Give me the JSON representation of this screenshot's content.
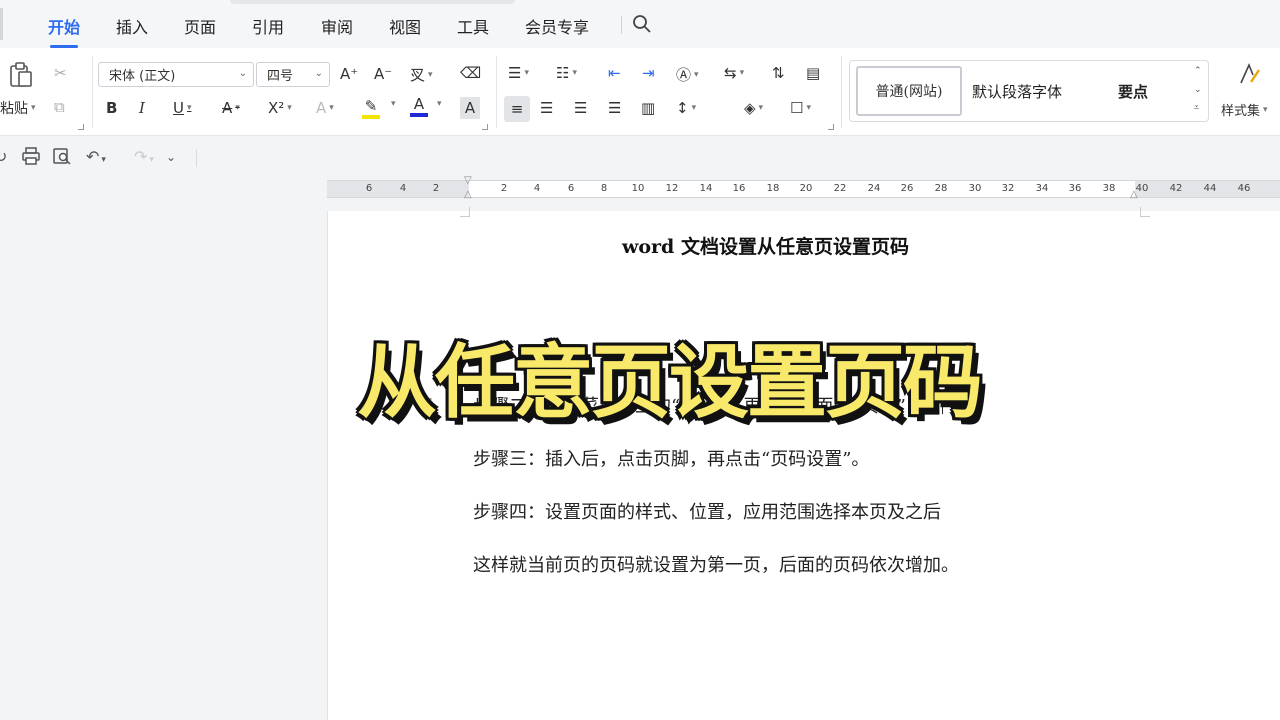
{
  "menu": {
    "tabs": [
      {
        "label": "开始",
        "active": true
      },
      {
        "label": "插入",
        "active": false
      },
      {
        "label": "页面",
        "active": false
      },
      {
        "label": "引用",
        "active": false
      },
      {
        "label": "审阅",
        "active": false
      },
      {
        "label": "视图",
        "active": false
      },
      {
        "label": "工具",
        "active": false
      },
      {
        "label": "会员专享",
        "active": false
      }
    ],
    "search_icon": "search-icon"
  },
  "ribbon": {
    "paste_label": "粘贴",
    "font_name": "宋体 (正文)",
    "font_size": "四号",
    "buttons": {
      "bold": "B",
      "italic": "I",
      "underline": "U",
      "strikethrough": "A",
      "superscript": "X²",
      "grow_font": "A⁺",
      "shrink_font": "A⁻",
      "font_color": "A",
      "char_shading": "A"
    },
    "styles": {
      "normal": "普通(网站)",
      "default_para_font": "默认段落字体",
      "key_point": "要点",
      "gallery_label": "样式集"
    },
    "colors": {
      "highlight": "#f2e600",
      "font_color": "#1d2bd6",
      "accent": "#2f6df0"
    }
  },
  "ruler": {
    "ticks": [
      "6",
      "4",
      "2",
      "2",
      "4",
      "6",
      "8",
      "10",
      "12",
      "14",
      "16",
      "18",
      "20",
      "22",
      "24",
      "26",
      "28",
      "30",
      "32",
      "34",
      "36",
      "38",
      "40",
      "42",
      "44",
      "46"
    ]
  },
  "document": {
    "title": "word 文档设置从任意页设置页码",
    "paragraphs": [
      "步骤二：点击菜单栏上的“插入”，再点击下面的“页码”",
      "步骤三：插入后，点击页脚，再点击“页码设置”。",
      "步骤四：设置页面的样式、位置，应用范围选择本页及之后",
      "这样就当前页的页码就设置为第一页，后面的页码依次增加。"
    ]
  },
  "overlay": {
    "caption": "从任意页设置页码"
  }
}
